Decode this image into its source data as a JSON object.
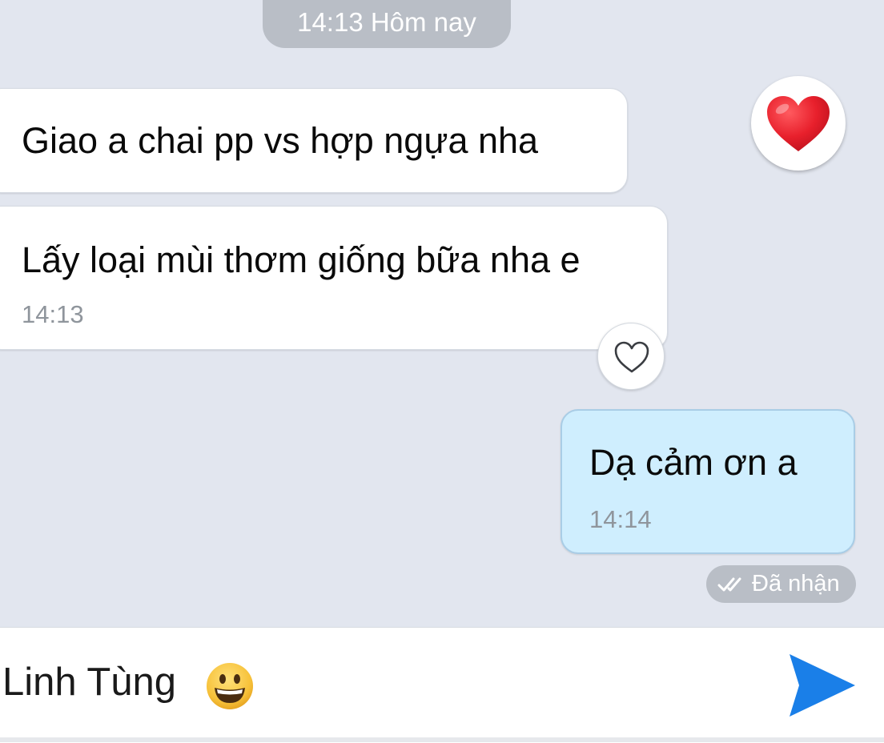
{
  "header": {
    "date_separator": "14:13 Hôm nay"
  },
  "messages": [
    {
      "direction": "incoming",
      "text": "Giao a chai pp vs hợp ngựa nha",
      "reaction": "heart-icon"
    },
    {
      "direction": "incoming",
      "text": "Lấy loại mùi thơm giống bữa nha e",
      "time": "14:13"
    },
    {
      "direction": "outgoing",
      "text": "Dạ cảm ơn a",
      "time": "14:14",
      "status": "Đã nhận"
    }
  ],
  "composer": {
    "value": "Linh Tùng",
    "emoji": "grinning-face-emoji",
    "send_icon": "send-icon"
  },
  "colors": {
    "chat_background": "#e2e6ef",
    "incoming_bubble": "#ffffff",
    "outgoing_bubble": "#cfeefe",
    "chip_background": "#b9bec6",
    "send_accent": "#1a7fe8",
    "heart_red": "#e8202c"
  }
}
